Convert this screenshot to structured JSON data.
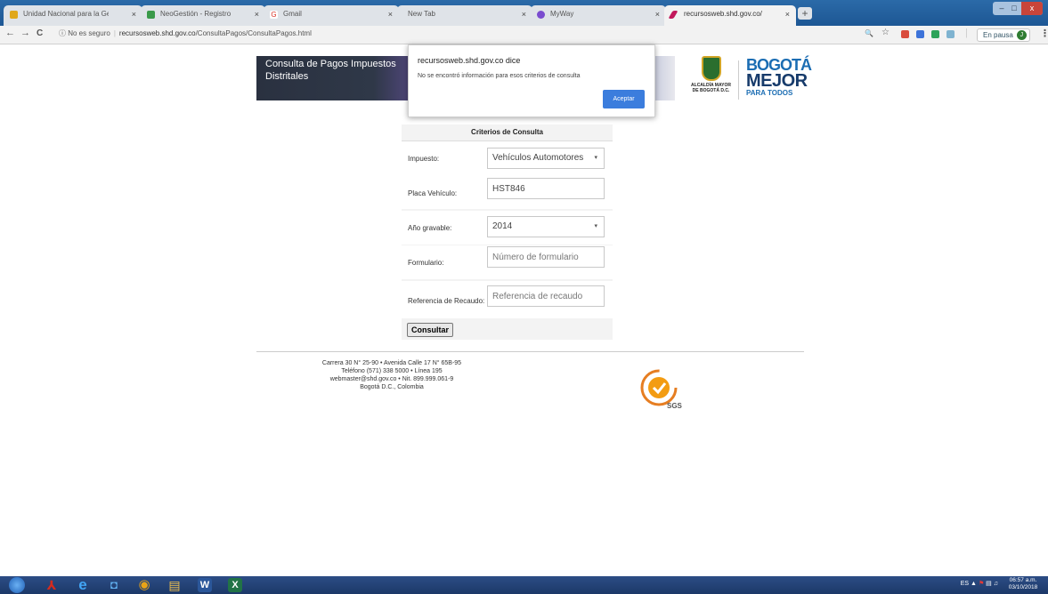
{
  "browser": {
    "tabs": [
      {
        "title": "Unidad Nacional para la Gestión",
        "favicon_color": "#e0a81b",
        "active": false
      },
      {
        "title": "NeoGestión - Registro de Entrad",
        "favicon_color": "#3a9a4a",
        "active": false
      },
      {
        "title": "Gmail",
        "favicon_color": "#d93025",
        "active": false
      },
      {
        "title": "New Tab",
        "favicon_color": "#dfe3e8",
        "active": false
      },
      {
        "title": "MyWay",
        "favicon_color": "#7a4ccf",
        "active": false
      },
      {
        "title": "recursosweb.shd.gov.co/Consulta",
        "favicon_color": "#c2185b",
        "active": true
      }
    ],
    "close_glyph": "×",
    "new_tab_glyph": "+",
    "win_min": "–",
    "win_max": "□",
    "win_close": "x",
    "back_glyph": "←",
    "forward_glyph": "→",
    "reload_glyph": "C",
    "info_glyph": "ⓘ",
    "security_label": "No es seguro",
    "url_host": "recursosweb.shd.gov.co",
    "url_path": "/ConsultaPagos/ConsultaPagos.html",
    "zoom_glyph": "🔍",
    "star_glyph": "☆",
    "profile_label": "En pausa",
    "profile_initial": "J",
    "menu_glyph": "⋮"
  },
  "banner": {
    "title": "Consulta de Pagos Impuestos Distritales"
  },
  "logos": {
    "alcaldia_text": "ALCALDÍA MAYOR DE BOGOTÁ D.C.",
    "bogota_line1": "BOGOTÁ",
    "bogota_line2": "MEJOR",
    "bogota_line3": "PARA TODOS"
  },
  "form": {
    "header": "Criterios de Consulta",
    "impuesto_label": "Impuesto:",
    "impuesto_value": "Vehículos Automotores",
    "placa_label": "Placa Vehículo:",
    "placa_value": "HST846",
    "anio_label": "Año gravable:",
    "anio_value": "2014",
    "formulario_label": "Formulario:",
    "formulario_placeholder": "Número de formulario",
    "referencia_label": "Referencia de Recaudo:",
    "referencia_placeholder": "Referencia de recaudo",
    "submit_label": "Consultar",
    "caret": "▾"
  },
  "footer": {
    "line1": "Carrera 30 N° 25-90 • Avenida Calle 17 N° 65B-95",
    "line2": "Teléfono (571) 338 5000 • Línea 195",
    "line3": "webmaster@shd.gov.co • Nit. 899.999.061-9",
    "line4": "Bogotá D.C., Colombia",
    "sgs_label": "SGS"
  },
  "dialog": {
    "title": "recursosweb.shd.gov.co dice",
    "message": "No se encontró información para esos criterios de consulta",
    "ok_label": "Aceptar"
  },
  "taskbar": {
    "apps": [
      {
        "name": "acrobat",
        "color": "#d52b1e",
        "glyph": "⅄"
      },
      {
        "name": "ie",
        "color": "#1e88e5",
        "glyph": "e"
      },
      {
        "name": "outlook",
        "color": "#1565c0",
        "glyph": "◘"
      },
      {
        "name": "chrome",
        "color": "#e8a317",
        "glyph": "◉"
      },
      {
        "name": "explorer",
        "color": "#f2c14e",
        "glyph": "▤"
      },
      {
        "name": "word",
        "color": "#2b579a",
        "glyph": "W"
      },
      {
        "name": "excel",
        "color": "#217346",
        "glyph": "X"
      }
    ],
    "language": "ES",
    "time": "06:57 a.m.",
    "date": "03/10/2018"
  },
  "colors": {
    "accent": "#3b7ddd",
    "tabstrip": "#2b6aa8",
    "taskbar": "#1c3868"
  }
}
